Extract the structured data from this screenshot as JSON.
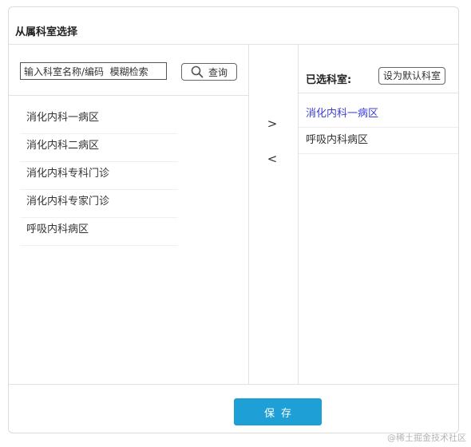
{
  "dialog": {
    "title": "从属科室选择"
  },
  "search": {
    "value": "输入科室名称/编码  模糊检索",
    "button_label": "查询",
    "icon": "search-icon"
  },
  "available_departments": [
    {
      "label": "消化内科一病区"
    },
    {
      "label": "消化内科二病区"
    },
    {
      "label": "消化内科专科门诊"
    },
    {
      "label": "消化内科专家门诊"
    },
    {
      "label": "呼吸内科病区"
    }
  ],
  "transfer": {
    "add_label": ">",
    "remove_label": "<"
  },
  "selected": {
    "label": "已选科室:",
    "default_button_label": "设为默认科室",
    "items": [
      {
        "label": "消化内科一病区",
        "active": true
      },
      {
        "label": "呼吸内科病区",
        "active": false
      }
    ]
  },
  "footer": {
    "save_label": "保存"
  },
  "watermark": "@稀土掘金技术社区",
  "colors": {
    "save_button": "#1e9fd6",
    "active_item": "#3d3dd6"
  }
}
